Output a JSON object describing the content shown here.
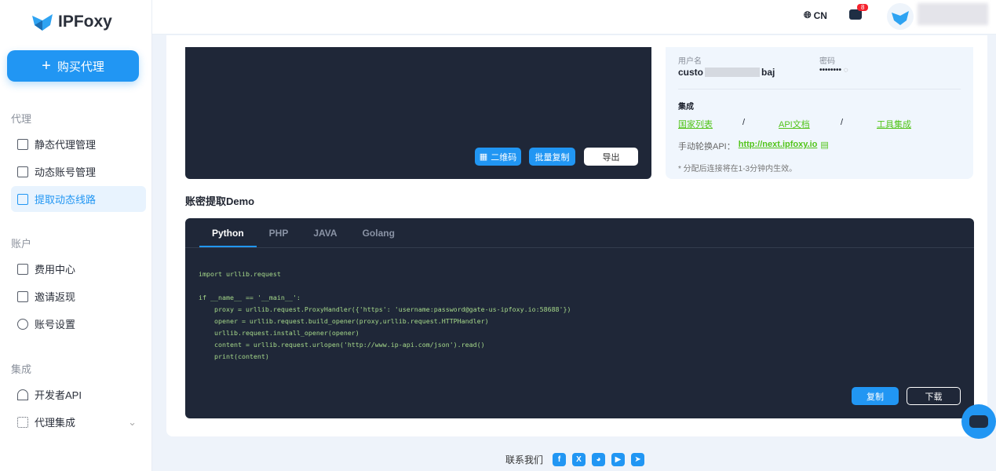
{
  "brand": {
    "name": "IPFoxy"
  },
  "sidebar": {
    "buy_label": "购买代理",
    "sections": [
      {
        "title": "代理",
        "items": [
          "静态代理管理",
          "动态账号管理",
          "提取动态线路"
        ]
      },
      {
        "title": "账户",
        "items": [
          "费用中心",
          "邀请返现",
          "账号设置"
        ]
      },
      {
        "title": "集成",
        "items": [
          "开发者API",
          "代理集成"
        ]
      }
    ]
  },
  "header": {
    "language": "CN",
    "notification_count": "8"
  },
  "extract": {
    "qr_label": "二维码",
    "batch_copy_label": "批量复制",
    "export_label": "导出"
  },
  "info": {
    "username_label": "用户名",
    "username_prefix": "custo",
    "username_suffix": "baj",
    "password_label": "密码",
    "password_value": "••••••••",
    "integration_title": "集成",
    "links": [
      "国家列表",
      "API文档",
      "工具集成"
    ],
    "separator": "/",
    "api_label": "手动轮换API：",
    "api_url": "http://next.ipfoxy.io",
    "note": "* 分配后连接将在1-3分钟内生效。"
  },
  "demo": {
    "title": "账密提取Demo",
    "tabs": [
      "Python",
      "PHP",
      "JAVA",
      "Golang"
    ],
    "code": "import urllib.request\n\nif __name__ == '__main__':\n    proxy = urllib.request.ProxyHandler({'https': 'username:password@gate-us-ipfoxy.io:58688'})\n    opener = urllib.request.build_opener(proxy,urllib.request.HTTPHandler)\n    urllib.request.install_opener(opener)\n    content = urllib.request.urlopen('http://www.ip-api.com/json').read()\n    print(content)",
    "copy_label": "复制",
    "download_label": "下载"
  },
  "footer": {
    "contact_label": "联系我们"
  },
  "colors": {
    "accent": "#2196f3",
    "link": "#52c41a",
    "dark_panel": "#1f2738"
  }
}
